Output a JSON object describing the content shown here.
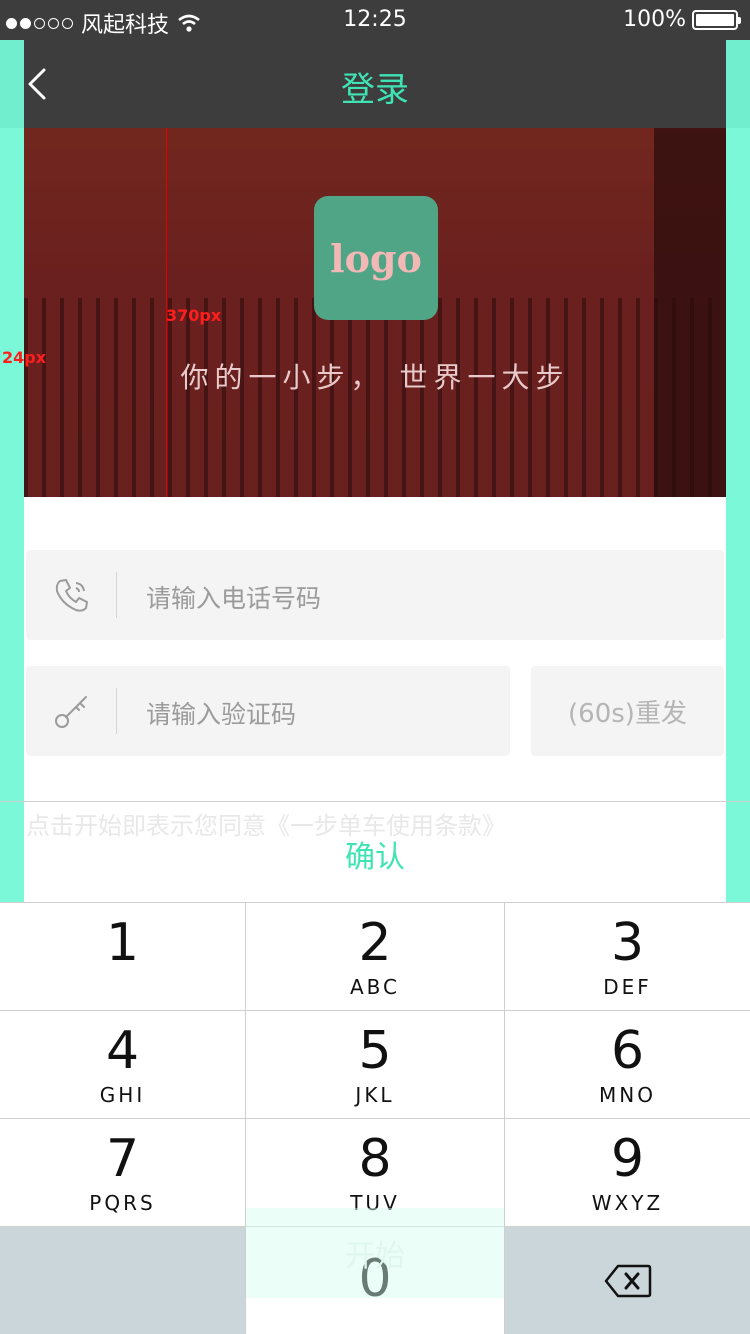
{
  "status_bar": {
    "carrier": "风起科技",
    "time": "12:25",
    "battery_percent": "100%",
    "signal_bars_filled": 2,
    "signal_bars_total": 5,
    "battery_level": 1.0
  },
  "nav": {
    "title": "登录",
    "back_icon": "chevron-left-icon"
  },
  "hero": {
    "logo_text": "logo",
    "slogan": "你的一小步， 世界一大步",
    "height_annotation": "370px",
    "side_annotation": "24px"
  },
  "form": {
    "phone_placeholder": "请输入电话号码",
    "phone_icon": "phone-icon",
    "code_placeholder": "请输入验证码",
    "code_icon": "key-icon",
    "resend_label": "(60s)重发",
    "agreement_text": "点击开始即表示您同意《一步单车使用条款》",
    "confirm_label": "确认",
    "start_label": "开始"
  },
  "keypad": {
    "keys": [
      {
        "digit": "1",
        "letters": ""
      },
      {
        "digit": "2",
        "letters": "ABC"
      },
      {
        "digit": "3",
        "letters": "DEF"
      },
      {
        "digit": "4",
        "letters": "GHI"
      },
      {
        "digit": "5",
        "letters": "JKL"
      },
      {
        "digit": "6",
        "letters": "MNO"
      },
      {
        "digit": "7",
        "letters": "PQRS"
      },
      {
        "digit": "8",
        "letters": "TUV"
      },
      {
        "digit": "9",
        "letters": "WXYZ"
      },
      {
        "digit": "0",
        "letters": ""
      }
    ],
    "delete_icon": "backspace-icon"
  },
  "colors": {
    "accent": "#3fe3b4",
    "guide": "#74f8d6",
    "bar": "#3d3d3d",
    "logo_bg": "#4fa586"
  }
}
